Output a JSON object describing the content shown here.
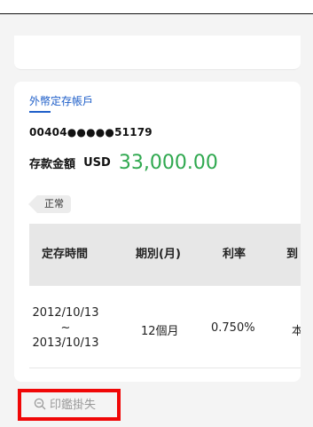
{
  "account_card": {
    "title": "外幣定存帳戶",
    "account_number": "00404●●●●●51179",
    "amount_label": "存款金額",
    "currency": "USD",
    "amount": "33,000.00",
    "status": "正常"
  },
  "table": {
    "headers": [
      "定存時間",
      "期別(月)",
      "利率",
      "到"
    ],
    "rows": [
      {
        "start_date": "2012/10/13",
        "separator": "~",
        "end_date": "2013/10/13",
        "period": "12個月",
        "rate": "0.750%",
        "extra": "本"
      }
    ]
  },
  "bottom_action": {
    "label": "印鑑掛失",
    "icon": "search-minus-icon"
  },
  "colors": {
    "title_blue": "#1f5fc9",
    "amount_green": "#2fa84f",
    "highlight_red": "#f00707"
  }
}
